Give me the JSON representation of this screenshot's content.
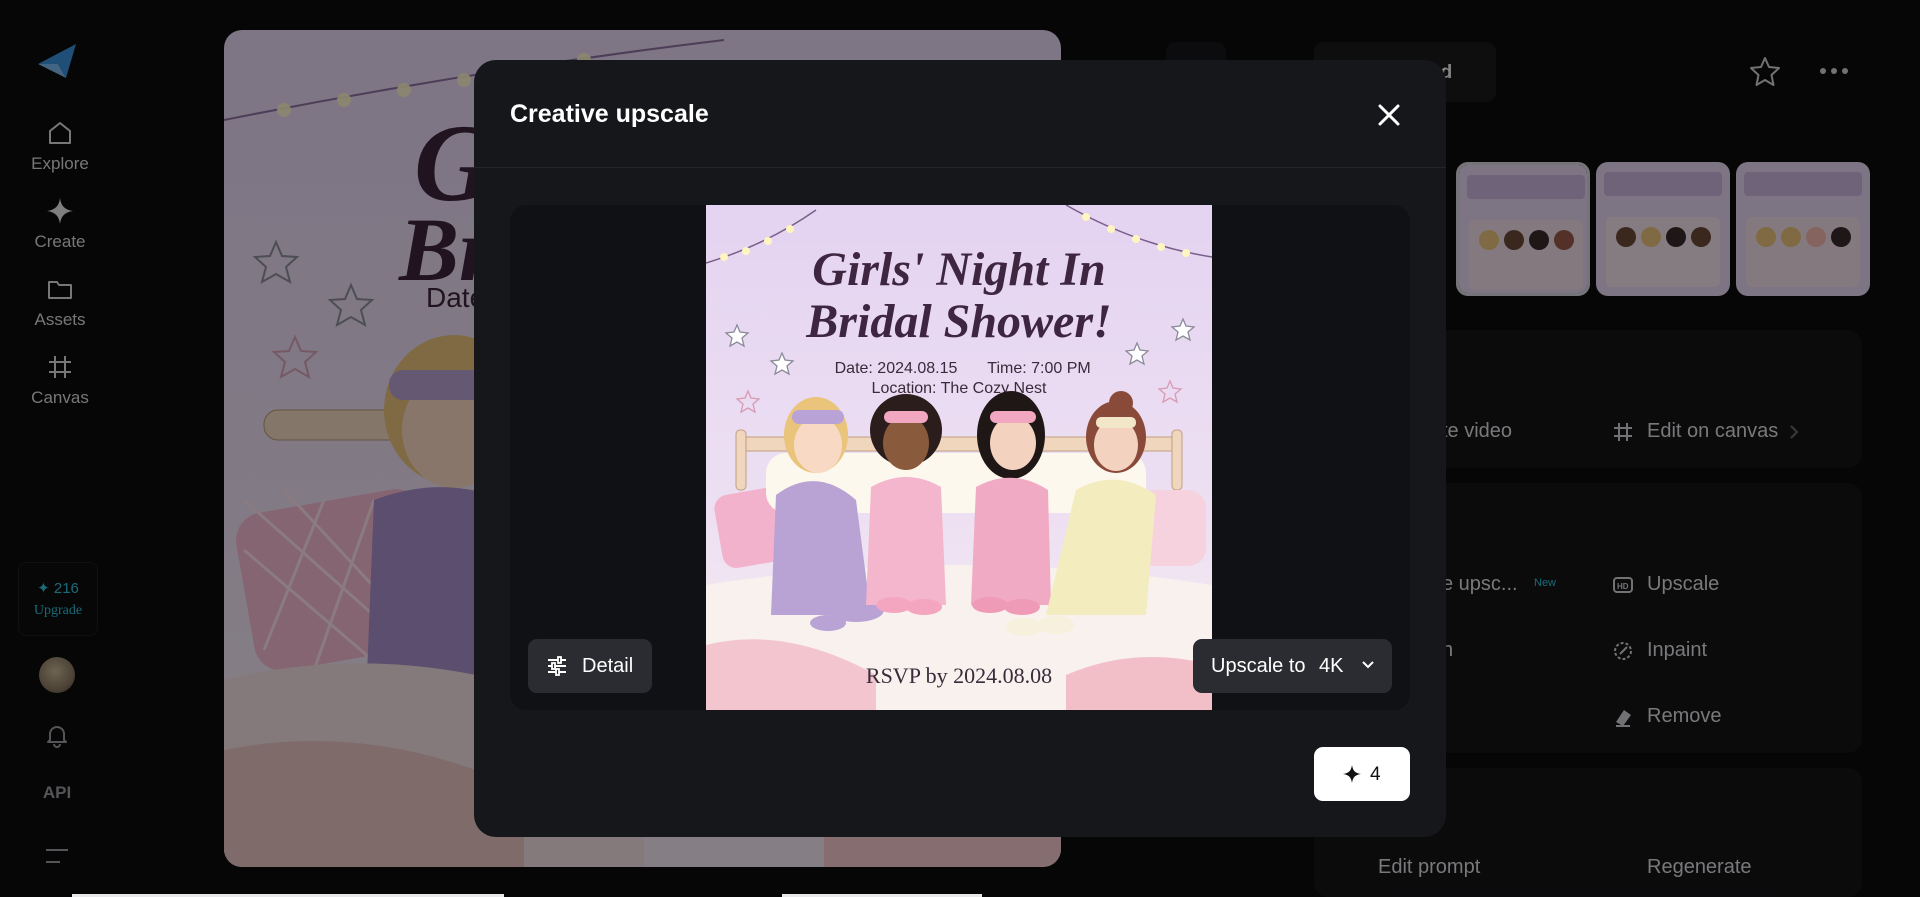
{
  "sidebar": {
    "items": [
      {
        "label": "Explore",
        "icon": "home-icon"
      },
      {
        "label": "Create",
        "icon": "sparkle-icon"
      },
      {
        "label": "Assets",
        "icon": "folder-icon"
      },
      {
        "label": "Canvas",
        "icon": "canvas-icon"
      }
    ],
    "credits": "✦ 216",
    "upgrade": "Upgrade",
    "api": "API"
  },
  "invite": {
    "title_line1": "Girls' Night In",
    "title_line2": "Bridal Shower!",
    "date": "Date: 2024.08.15",
    "time": "Time: 7:00 PM",
    "location": "Location: The Cozy Nest",
    "rsvp": "RSVP by 2024.08.08",
    "bg_title_fragment_1": "Gi",
    "bg_title_fragment_2": "Br",
    "bg_date_fragment": "Date"
  },
  "right_panel": {
    "download_label": "ad",
    "create_video_label": "te video",
    "edit_canvas_label": "Edit on canvas",
    "creative_upscale_label": "e upsc...",
    "new_badge": "New",
    "upscale_label": "Upscale",
    "n_label": "n",
    "inpaint_label": "Inpaint",
    "remove_label": "Remove",
    "edit_prompt_label": "Edit prompt",
    "regenerate_label": "Regenerate"
  },
  "modal": {
    "title": "Creative upscale",
    "detail_label": "Detail",
    "upscale_to_label": "Upscale to",
    "upscale_value": "4K",
    "cost": "4"
  },
  "colors": {
    "accent_cyan": "#2fc4d8",
    "invite_lavender": "#e4d4f0",
    "title_plum": "#4a2a4a"
  }
}
